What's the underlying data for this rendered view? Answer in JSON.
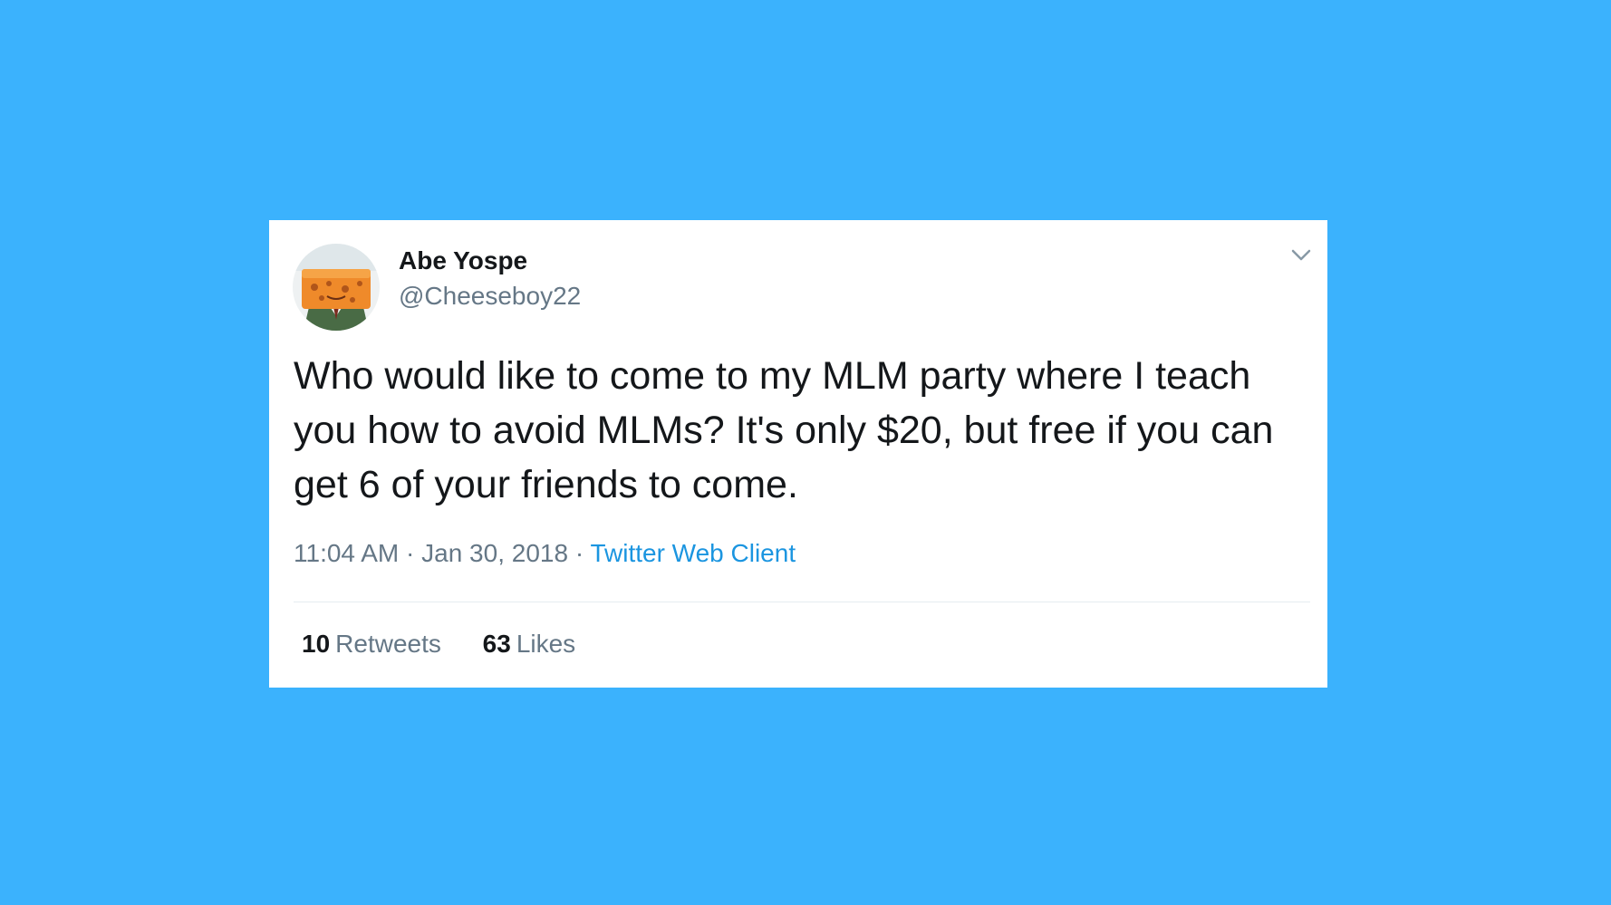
{
  "colors": {
    "background": "#3bb2fd",
    "card": "#ffffff",
    "primary_text": "#14171a",
    "secondary_text": "#657786",
    "link": "#1b95e0",
    "divider": "#e6ecf0"
  },
  "tweet": {
    "author": {
      "display_name": "Abe Yospe",
      "handle": "@Cheeseboy22",
      "avatar_icon": "cheese-character-avatar"
    },
    "menu_icon": "chevron-down-icon",
    "text": "Who would like to come to my MLM party where I teach you how to avoid MLMs? It's only $20, but free if you can get 6 of your friends to come.",
    "time": "11:04 AM",
    "separator": "·",
    "date": "Jan 30, 2018",
    "source": "Twitter Web Client",
    "stats": {
      "retweets_count": "10",
      "retweets_label": "Retweets",
      "likes_count": "63",
      "likes_label": "Likes"
    }
  }
}
